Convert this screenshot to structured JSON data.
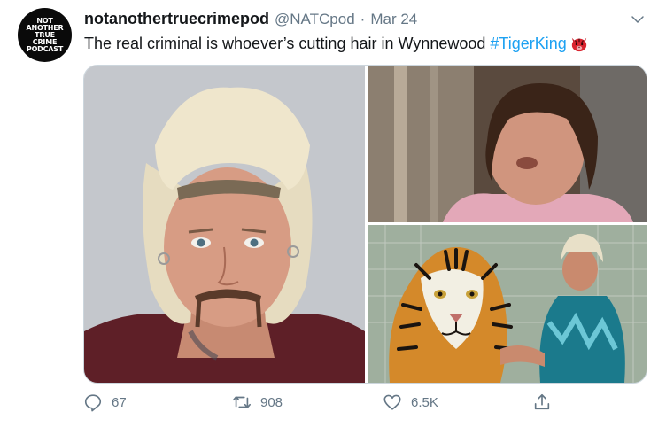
{
  "tweet": {
    "avatar_text": "NOT ANOTHER TRUE CRIME PODCAST",
    "display_name": "notanothertruecrimepod",
    "handle": "@NATCpod",
    "separator": "·",
    "date": "Mar 24",
    "text": "The real criminal is whoever’s cutting hair in Wynnewood",
    "hashtag": "#TigerKing",
    "emoji": "tiger-face-emoji"
  },
  "media": {
    "photos": [
      "mugshot-photo",
      "interview-photo",
      "tiger-photo"
    ]
  },
  "actions": {
    "reply_count": "67",
    "retweet_count": "908",
    "like_count": "6.5K"
  },
  "colors": {
    "link": "#1da1f2",
    "secondary_text": "#657786",
    "primary_text": "#14171a",
    "border": "#ccd6dd"
  },
  "icons": [
    "reply-icon",
    "retweet-icon",
    "like-icon",
    "share-icon",
    "chevron-down-icon"
  ]
}
